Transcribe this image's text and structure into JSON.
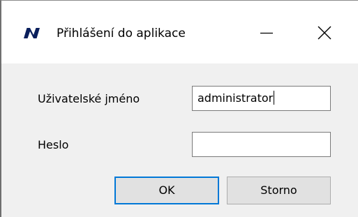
{
  "window": {
    "title": "Přihlášení do aplikace",
    "icon": "app-logo-icon",
    "controls": {
      "minimize_icon": "minimize-icon",
      "close_icon": "close-icon"
    }
  },
  "form": {
    "username_label": "Uživatelské jméno",
    "username_value": "administrator",
    "password_label": "Heslo",
    "password_value": ""
  },
  "buttons": {
    "ok_label": "OK",
    "cancel_label": "Storno"
  },
  "colors": {
    "logo": "#0a1f5c",
    "focus_border": "#0078d7",
    "dialog_background": "#f0f0f0",
    "titlebar_background": "#ffffff",
    "button_face": "#e1e1e1"
  }
}
